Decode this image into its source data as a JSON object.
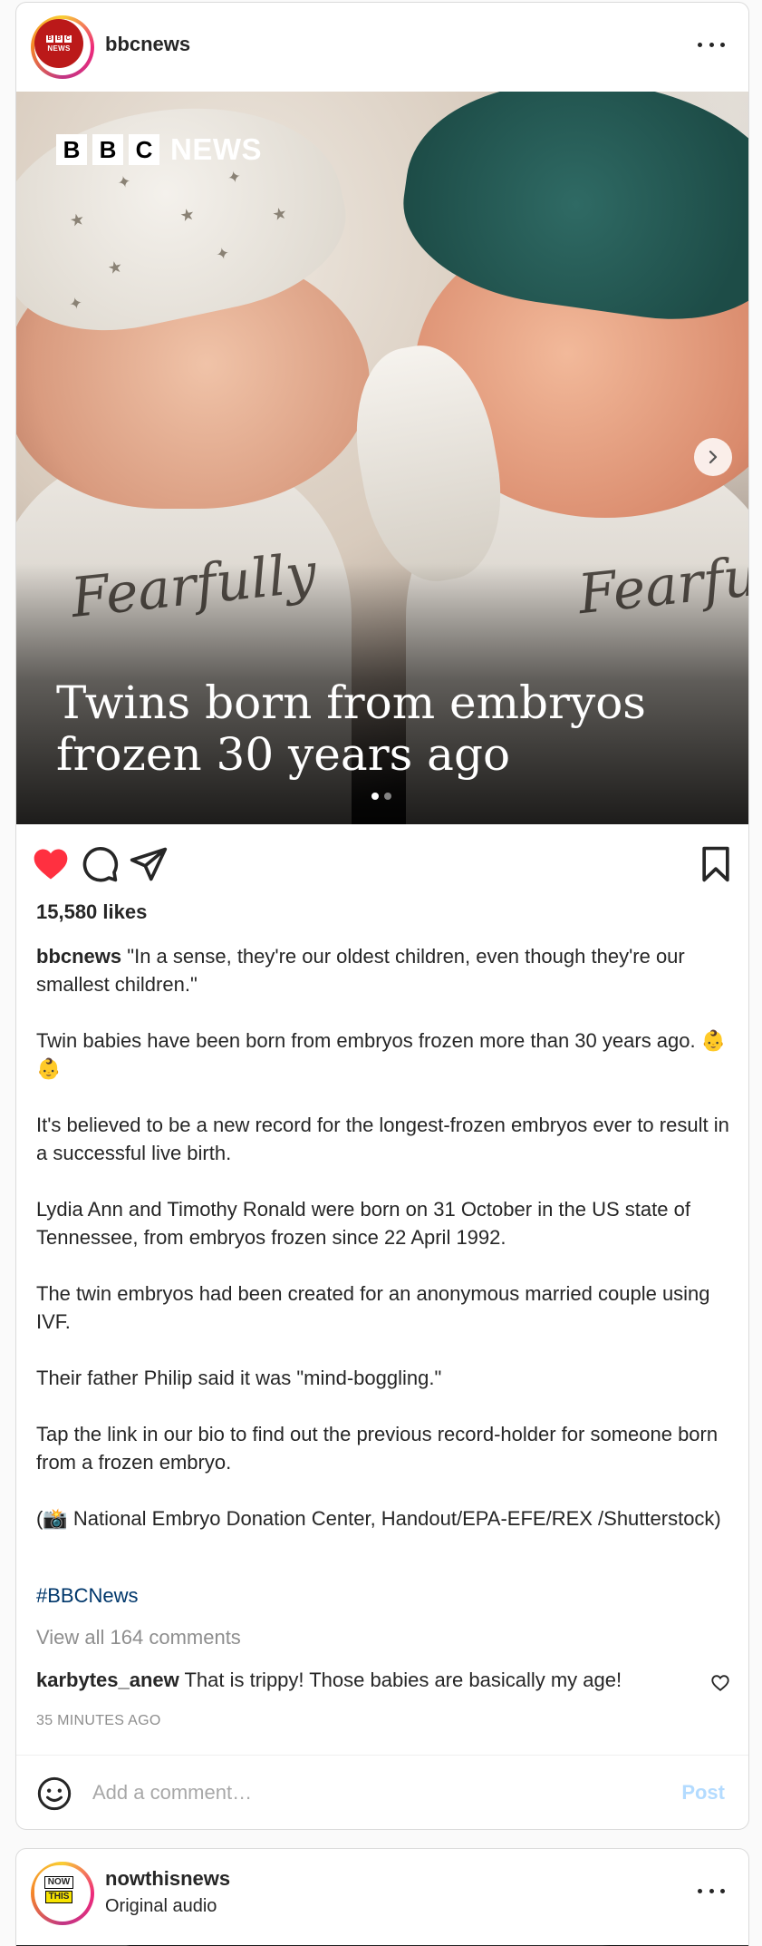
{
  "post1": {
    "username": "bbcnews",
    "avatar": {
      "logo_blocks": [
        "B",
        "B",
        "C"
      ],
      "logo_word": "NEWS"
    },
    "media": {
      "brand_blocks": [
        "B",
        "B",
        "C"
      ],
      "brand_word": "NEWS",
      "headline_line1": "Twins born from embryos",
      "headline_line2": "frozen 30 years ago",
      "onesie_text_left": "Fearfully",
      "onesie_text_right": "Fearfu",
      "carousel_count": 2,
      "carousel_active": 1
    },
    "actions": {
      "like_icon": "heart-filled-icon",
      "comment_icon": "comment-icon",
      "share_icon": "send-icon",
      "save_icon": "bookmark-icon",
      "liked": true,
      "like_color": "#ff3040"
    },
    "likes": "15,580 likes",
    "caption": {
      "handle": "bbcnews",
      "p1": "\"In a sense, they're our oldest children, even though they're our smallest children.\"",
      "p2": "Twin babies have been born from embryos frozen more than 30 years ago. 👶👶",
      "p3": "It's believed to be a new record for the longest-frozen embryos ever to result in a successful live birth.",
      "p4": "Lydia Ann and Timothy Ronald were born on 31 October in the US state of Tennessee, from embryos frozen since 22 April 1992.",
      "p5": "The twin embryos had been created for an anonymous married couple using IVF.",
      "p6": "Their father Philip said it was \"mind-boggling.\"",
      "p7": "Tap the link in our bio to find out the previous record-holder for someone born from a frozen embryo.",
      "p8": "(📸 National Embryo Donation Center, Handout/EPA-EFE/REX /Shutterstock)"
    },
    "hashtag": "#BBCNews",
    "view_comments": "View all 164 comments",
    "top_comment": {
      "handle": "karbytes_anew",
      "text": "That is trippy! Those babies are basically my age!"
    },
    "timestamp": "35 MINUTES AGO",
    "add_comment": {
      "placeholder": "Add a comment…",
      "post_label": "Post"
    }
  },
  "post2": {
    "username": "nowthisnews",
    "subline": "Original audio",
    "avatar": {
      "line1": "NOW",
      "line2": "THIS"
    }
  },
  "colors": {
    "link": "#00376b",
    "muted": "#8e8e8e",
    "post_disabled": "#b3dbff",
    "bbc_red": "#bb1919"
  }
}
